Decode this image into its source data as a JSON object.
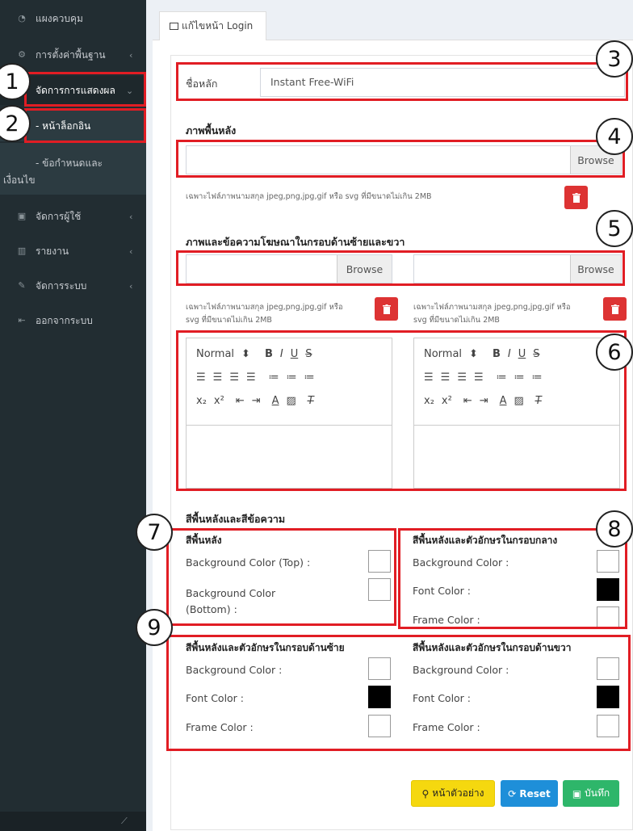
{
  "sidebar": {
    "items": [
      {
        "label": "แผงควบคุม",
        "icon": "dashboard-icon"
      },
      {
        "label": "การตั้งค่าพื้นฐาน",
        "icon": "gear-icon"
      },
      {
        "label": "จัดการการแสดงผล",
        "icon": "display-icon"
      },
      {
        "label": "- หน้าล็อกอิน"
      },
      {
        "label": "- ข้อกำหนดและ",
        "label2": "เงื่อนไข"
      },
      {
        "label": "จัดการผู้ใช้",
        "icon": "user-icon"
      },
      {
        "label": "รายงาน",
        "icon": "chart-icon"
      },
      {
        "label": "จัดการระบบ",
        "icon": "wrench-icon"
      },
      {
        "label": "ออกจากระบบ",
        "icon": "logout-icon"
      }
    ]
  },
  "tab": {
    "label": "แก้ไขหน้า Login"
  },
  "form": {
    "main_name_label": "ชื่อหลัก",
    "main_name_value": "Instant Free-WiFi",
    "bg_image_heading": "ภาพพื้นหลัง",
    "browse_label": "Browse",
    "bg_image_note": "เฉพาะไฟล์ภาพนามสกุล jpeg,png,jpg,gif หรือ svg ที่มีขนาดไม่เกิน 2MB",
    "ads_heading": "ภาพและข้อความโฆษณาในกรอบด้านซ้ายและขวา",
    "ads_note_line1": "เฉพาะไฟล์ภาพนามสกุล jpeg,png,jpg,gif หรือ",
    "ads_note_line2": "svg ที่มีขนาดไม่เกิน 2MB",
    "editor_font": "Normal",
    "colors_heading": "สีพื้นหลังและสีข้อความ",
    "bg_group": {
      "title": "สีพื้นหลัง",
      "top_label": "Background Color (Top) :",
      "bottom_label_1": "Background Color",
      "bottom_label_2": "(Bottom) :"
    },
    "center_group": {
      "title": "สีพื้นหลังและตัวอักษรในกรอบกลาง",
      "bg_label": "Background Color :",
      "font_label": "Font Color :",
      "frame_label": "Frame Color :"
    },
    "left_group": {
      "title": "สีพื้นหลังและตัวอักษรในกรอบด้านซ้าย",
      "bg_label": "Background Color :",
      "font_label": "Font Color :",
      "frame_label": "Frame Color :"
    },
    "right_group": {
      "title": "สีพื้นหลังและตัวอักษรในกรอบด้านขวา",
      "bg_label": "Background Color :",
      "font_label": "Font Color :",
      "frame_label": "Frame Color :"
    }
  },
  "buttons": {
    "preview": "หน้าตัวอย่าง",
    "reset": "Reset",
    "save": "บันทึก"
  },
  "callouts": [
    "1",
    "2",
    "3",
    "4",
    "5",
    "6",
    "7",
    "8",
    "9"
  ],
  "colors": {
    "accent_red": "#e11d24",
    "sidebar_bg": "#222d32"
  }
}
